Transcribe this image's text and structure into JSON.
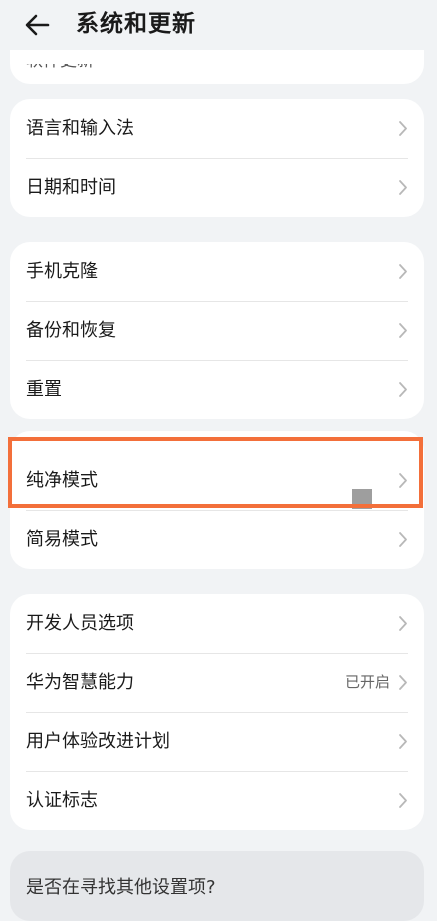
{
  "header": {
    "title": "系统和更新"
  },
  "partial_row": {
    "label": "软件更新"
  },
  "group1": [
    {
      "label": "语言和输入法"
    },
    {
      "label": "日期和时间"
    }
  ],
  "group2": [
    {
      "label": "手机克隆"
    },
    {
      "label": "备份和恢复"
    },
    {
      "label": "重置"
    }
  ],
  "group3": [
    {
      "label": "纯净模式"
    },
    {
      "label": "简易模式"
    }
  ],
  "group4": [
    {
      "label": "开发人员选项"
    },
    {
      "label": "华为智慧能力",
      "value": "已开启"
    },
    {
      "label": "用户体验改进计划"
    },
    {
      "label": "认证标志"
    }
  ],
  "search_suggestion": {
    "label": "是否在寻找其他设置项?"
  },
  "colors": {
    "highlight_border": "#f36f3a",
    "background": "#f1f3f5"
  }
}
